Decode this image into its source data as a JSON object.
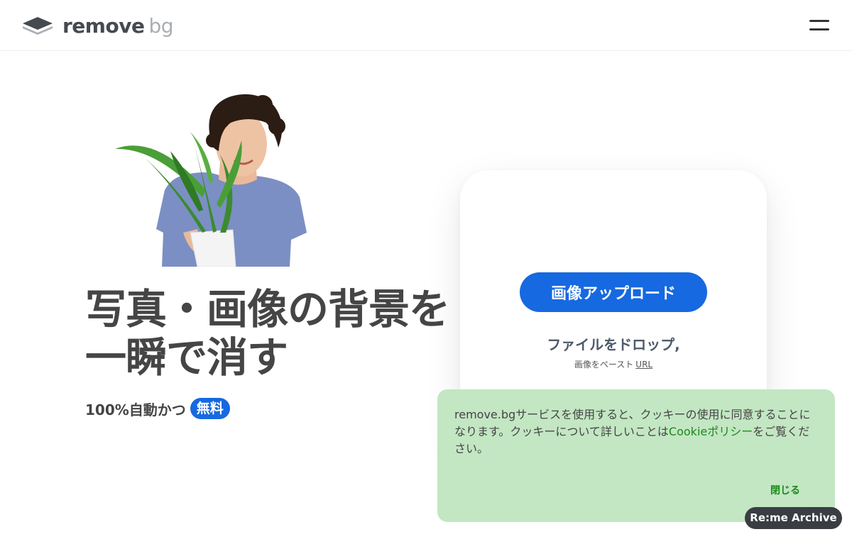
{
  "header": {
    "logo_word1": "remove",
    "logo_word2": "bg",
    "menu_icon": "hamburger-icon"
  },
  "hero": {
    "headline": "写真・画像の背景を一瞬で消す",
    "subline_prefix": "100%自動かつ",
    "free_badge": "無料"
  },
  "upload": {
    "button_label": "画像アップロード",
    "drop_text": "ファイルをドロップ,",
    "paste_text": "画像をペースト",
    "url_link": "URL"
  },
  "cookie_banner": {
    "text_before": "remove.bgサービスを使用すると、クッキーの使用に同意することになります。クッキーについて詳しいことは",
    "policy_link": "Cookieポリシー",
    "text_after": "をご覧ください。",
    "close_label": "閉じる"
  },
  "archive_badge": "Re:me Archive",
  "colors": {
    "accent": "#1669e0",
    "cookie_bg": "#c3e6c3",
    "cookie_link": "#1a8a1a",
    "text": "#454545"
  }
}
